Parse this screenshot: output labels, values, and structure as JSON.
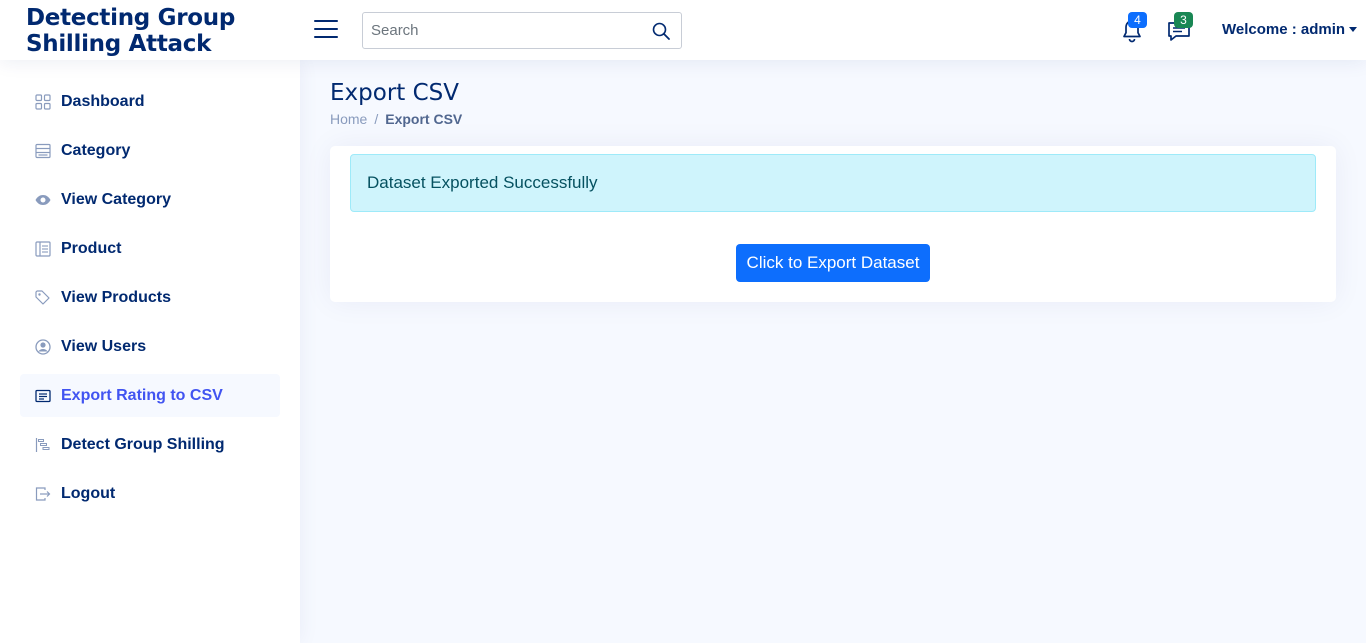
{
  "app": {
    "logo_line1": "Detecting Group",
    "logo_line2": "Shilling Attack"
  },
  "header": {
    "search_placeholder": "Search",
    "notifications_count": "4",
    "messages_count": "3",
    "welcome_label": "Welcome : admin"
  },
  "sidebar": {
    "items": [
      {
        "label": "Dashboard",
        "icon": "grid-icon"
      },
      {
        "label": "Category",
        "icon": "menu-list-icon"
      },
      {
        "label": "View Category",
        "icon": "eye-icon"
      },
      {
        "label": "Product",
        "icon": "layout-text-icon"
      },
      {
        "label": "View Products",
        "icon": "tags-icon"
      },
      {
        "label": "View Users",
        "icon": "person-circle-icon"
      },
      {
        "label": "Export Rating to CSV",
        "icon": "card-list-icon",
        "active": true
      },
      {
        "label": "Detect Group Shilling",
        "icon": "bar-chart-steps-icon"
      },
      {
        "label": "Logout",
        "icon": "box-arrow-right-icon"
      }
    ]
  },
  "main": {
    "title": "Export CSV",
    "breadcrumb": {
      "home": "Home",
      "sep": "/",
      "current": "Export CSV"
    },
    "alert_text": "Dataset Exported Successfully",
    "export_button_label": "Click to Export Dataset"
  },
  "colors": {
    "primary": "#0d6efd",
    "navy": "#012970",
    "active_link": "#4154f1",
    "alert_bg": "#cff4fc",
    "page_bg": "#f6f9ff"
  }
}
